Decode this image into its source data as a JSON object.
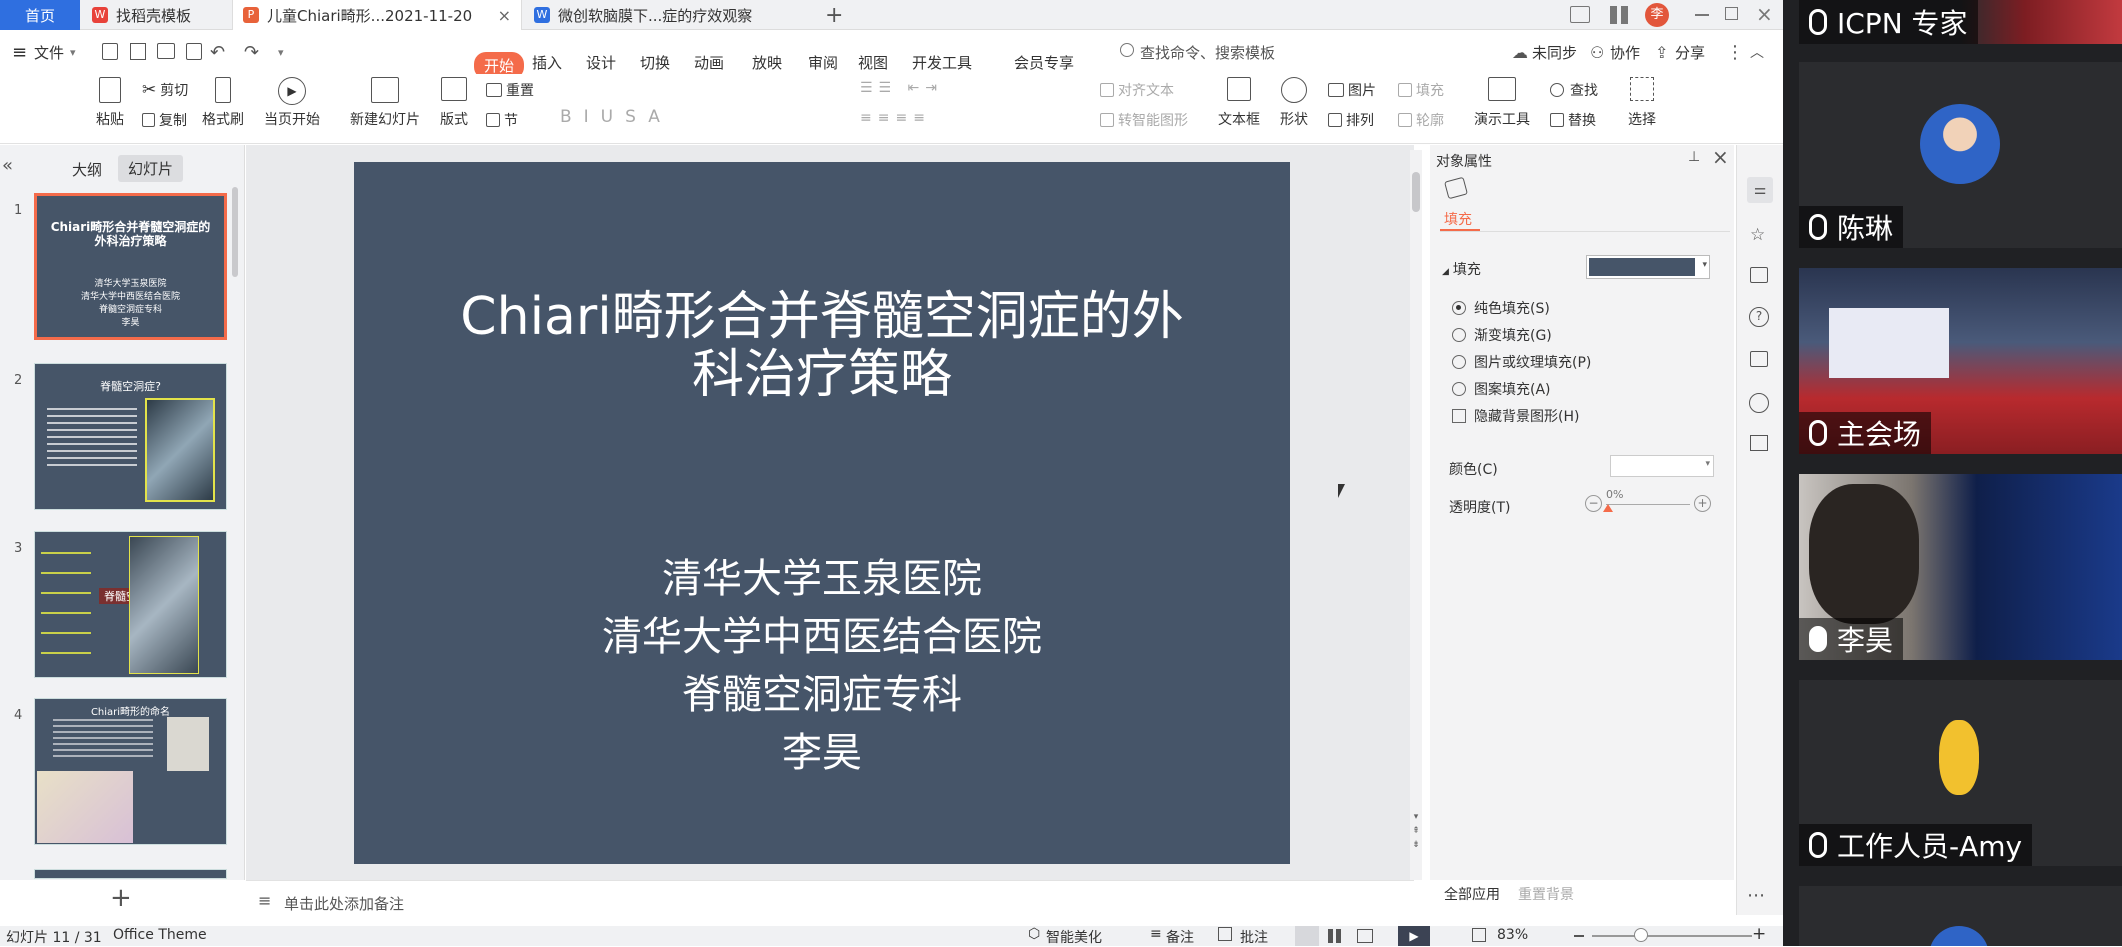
{
  "tabs": {
    "home": "首页",
    "t1": "找稻壳模板",
    "t2": "儿童Chiari畸形...2021-11-20",
    "t3": "微创软脑膜下...症的疗效观察",
    "add": "+"
  },
  "menu": {
    "file": "文件",
    "items": [
      "开始",
      "插入",
      "设计",
      "切换",
      "动画",
      "放映",
      "审阅",
      "视图",
      "开发工具",
      "会员专享"
    ],
    "search": "查找命令、搜索模板",
    "unsynced": "未同步",
    "collab": "协作",
    "share": "分享"
  },
  "ribbon": {
    "paste": "粘贴",
    "cut": "剪切",
    "copy": "复制",
    "format_painter": "格式刷",
    "from_current": "当页开始",
    "new_slide": "新建幻灯片",
    "layout": "版式",
    "section": "节",
    "reset": "重置",
    "text_to_table": "对齐文本",
    "convert_smartart": "转智能图形",
    "textbox": "文本框",
    "shape": "形状",
    "picture": "图片",
    "arrange": "排列",
    "fill": "填充",
    "outline": "轮廓",
    "presenter": "演示工具",
    "find": "查找",
    "replace": "替换",
    "select": "选择"
  },
  "leftpanel": {
    "outline_tab": "大纲",
    "slides_tab": "幻灯片",
    "thumbs": [
      {
        "num": "1",
        "title": "Chiari畸形合并脊髓空洞症的外科治疗策略",
        "lines": [
          "清华大学玉泉医院",
          "清华大学中西医结合医院",
          "脊髓空洞症专科",
          "李昊"
        ]
      },
      {
        "num": "2",
        "title": "脊髓空洞症?"
      },
      {
        "num": "3",
        "title": "脊髓空洞"
      },
      {
        "num": "4",
        "title": "Chiari畸形的命名"
      }
    ]
  },
  "slide": {
    "title": "Chiari畸形合并脊髓空洞症的外科治疗策略",
    "title_line1": "Chiari畸形合并脊髓空洞症的外",
    "title_line2": "科治疗策略",
    "lines": [
      "清华大学玉泉医院",
      "清华大学中西医结合医院",
      "脊髓空洞症专科",
      "李昊"
    ],
    "bg_color": "#465569"
  },
  "rightpanel": {
    "header": "对象属性",
    "fill_tab": "填充",
    "fill_section": "填充",
    "options": [
      "纯色填充(S)",
      "渐变填充(G)",
      "图片或纹理填充(P)",
      "图案填充(A)"
    ],
    "hide_bg": "隐藏背景图形(H)",
    "color_label": "颜色(C)",
    "transparency_label": "透明度(T)",
    "transparency_value": "0%",
    "apply_all": "全部应用",
    "reset_bg": "重置背景"
  },
  "notes": {
    "placeholder": "单击此处添加备注"
  },
  "status": {
    "slide_pos": "幻灯片 11 / 31",
    "theme": "Office Theme",
    "beautify": "智能美化",
    "notes": "备注",
    "comments": "批注",
    "zoom": "83%"
  },
  "videocall": {
    "participants": [
      {
        "name": "ICPN 专家"
      },
      {
        "name": "陈琳"
      },
      {
        "name": "主会场"
      },
      {
        "name": "李昊"
      },
      {
        "name": "工作人员-Amy"
      }
    ]
  },
  "colors": {
    "accent": "#f46b4a",
    "home_tab": "#2f6fe0",
    "slide_bg": "#465569"
  }
}
